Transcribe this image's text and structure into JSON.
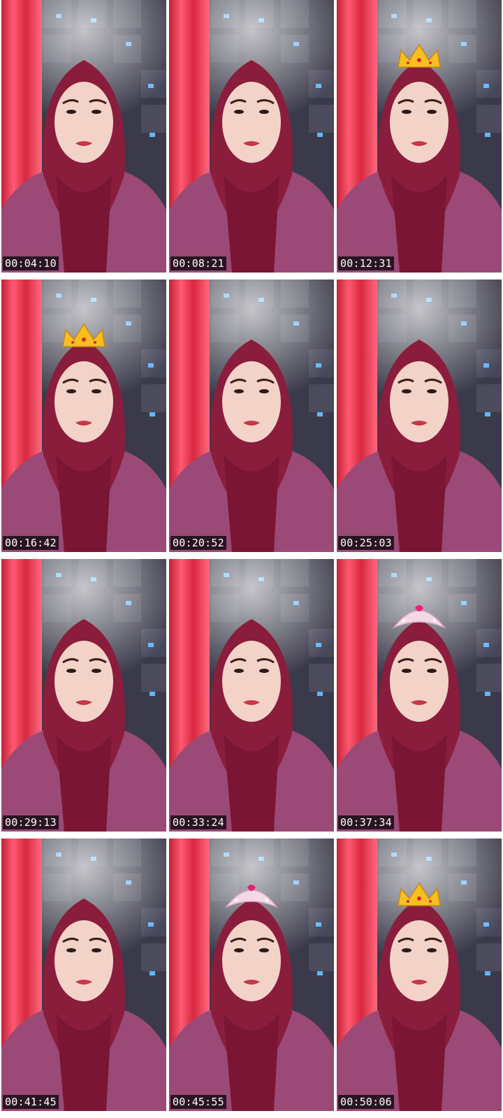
{
  "tiles": [
    {
      "timestamp": "00:04:10",
      "overlay": "none"
    },
    {
      "timestamp": "00:08:21",
      "overlay": "none"
    },
    {
      "timestamp": "00:12:31",
      "overlay": "gold-crown-small"
    },
    {
      "timestamp": "00:16:42",
      "overlay": "gold-crown"
    },
    {
      "timestamp": "00:20:52",
      "overlay": "none"
    },
    {
      "timestamp": "00:25:03",
      "overlay": "none"
    },
    {
      "timestamp": "00:29:13",
      "overlay": "none"
    },
    {
      "timestamp": "00:33:24",
      "overlay": "none"
    },
    {
      "timestamp": "00:37:34",
      "overlay": "pink-tiara"
    },
    {
      "timestamp": "00:41:45",
      "overlay": "none"
    },
    {
      "timestamp": "00:45:55",
      "overlay": "pink-tiara"
    },
    {
      "timestamp": "00:50:06",
      "overlay": "gold-crown"
    }
  ],
  "colors": {
    "curtain": "#e0344e",
    "hijab": "#8a1c3c",
    "shirt": "#9b4a78",
    "skin": "#f3d2c8",
    "wall": "#3a3a4a",
    "timestamp_bg": "#000000"
  }
}
